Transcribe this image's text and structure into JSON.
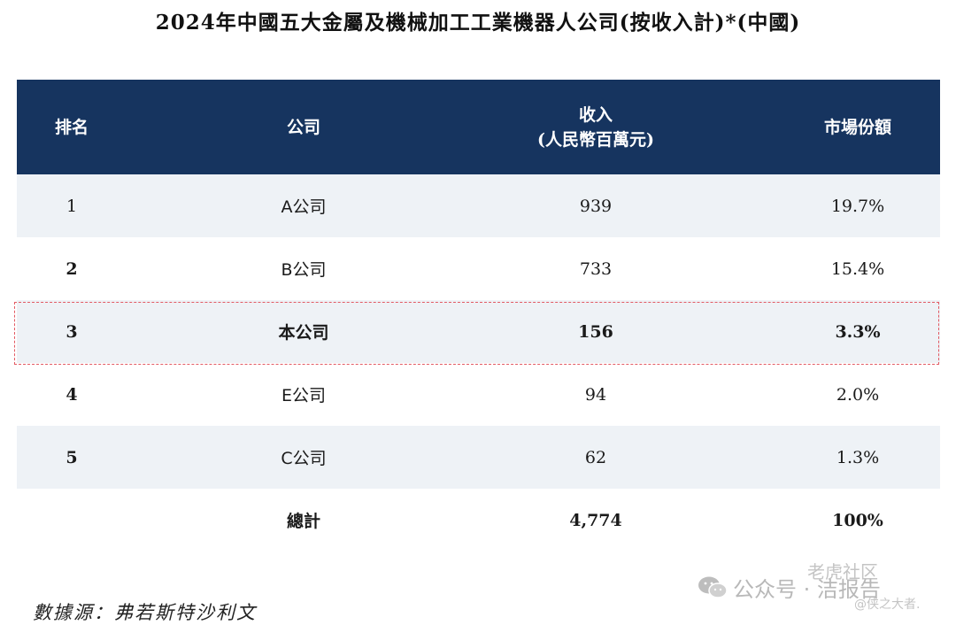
{
  "title": "2024年中國五大金屬及機械加工工業機器人公司(按收入計)*(中國)",
  "columns": {
    "rank": "排名",
    "company": "公司",
    "revenue_line1": "收入",
    "revenue_line2": "(人民幣百萬元)",
    "share": "市場份額"
  },
  "rows": [
    {
      "rank": "1",
      "company": "A公司",
      "revenue": "939",
      "share": "19.7%"
    },
    {
      "rank": "2",
      "company": "B公司",
      "revenue": "733",
      "share": "15.4%"
    },
    {
      "rank": "3",
      "company": "本公司",
      "revenue": "156",
      "share": "3.3%"
    },
    {
      "rank": "4",
      "company": "E公司",
      "revenue": "94",
      "share": "2.0%"
    },
    {
      "rank": "5",
      "company": "C公司",
      "revenue": "62",
      "share": "1.3%"
    }
  ],
  "total": {
    "label": "總計",
    "revenue": "4,774",
    "share": "100%"
  },
  "source": "數據源：弗若斯特沙利文",
  "watermark": {
    "top": "老虎社区",
    "main": "公众号 · 洁报告",
    "bottom": "@侠之大者."
  },
  "colors": {
    "header_bg": "#16345f",
    "row_shade": "#eef2f6",
    "highlight_border": "#e25a63"
  },
  "chart_data": {
    "type": "table",
    "title": "2024年中國五大金屬及機械加工工業機器人公司(按收入計)*(中國)",
    "columns": [
      "排名",
      "公司",
      "收入(人民幣百萬元)",
      "市場份額"
    ],
    "rows": [
      [
        "1",
        "A公司",
        939,
        "19.7%"
      ],
      [
        "2",
        "B公司",
        733,
        "15.4%"
      ],
      [
        "3",
        "本公司",
        156,
        "3.3%"
      ],
      [
        "4",
        "E公司",
        94,
        "2.0%"
      ],
      [
        "5",
        "C公司",
        62,
        "1.3%"
      ],
      [
        "",
        "總計",
        4774,
        "100%"
      ]
    ]
  }
}
